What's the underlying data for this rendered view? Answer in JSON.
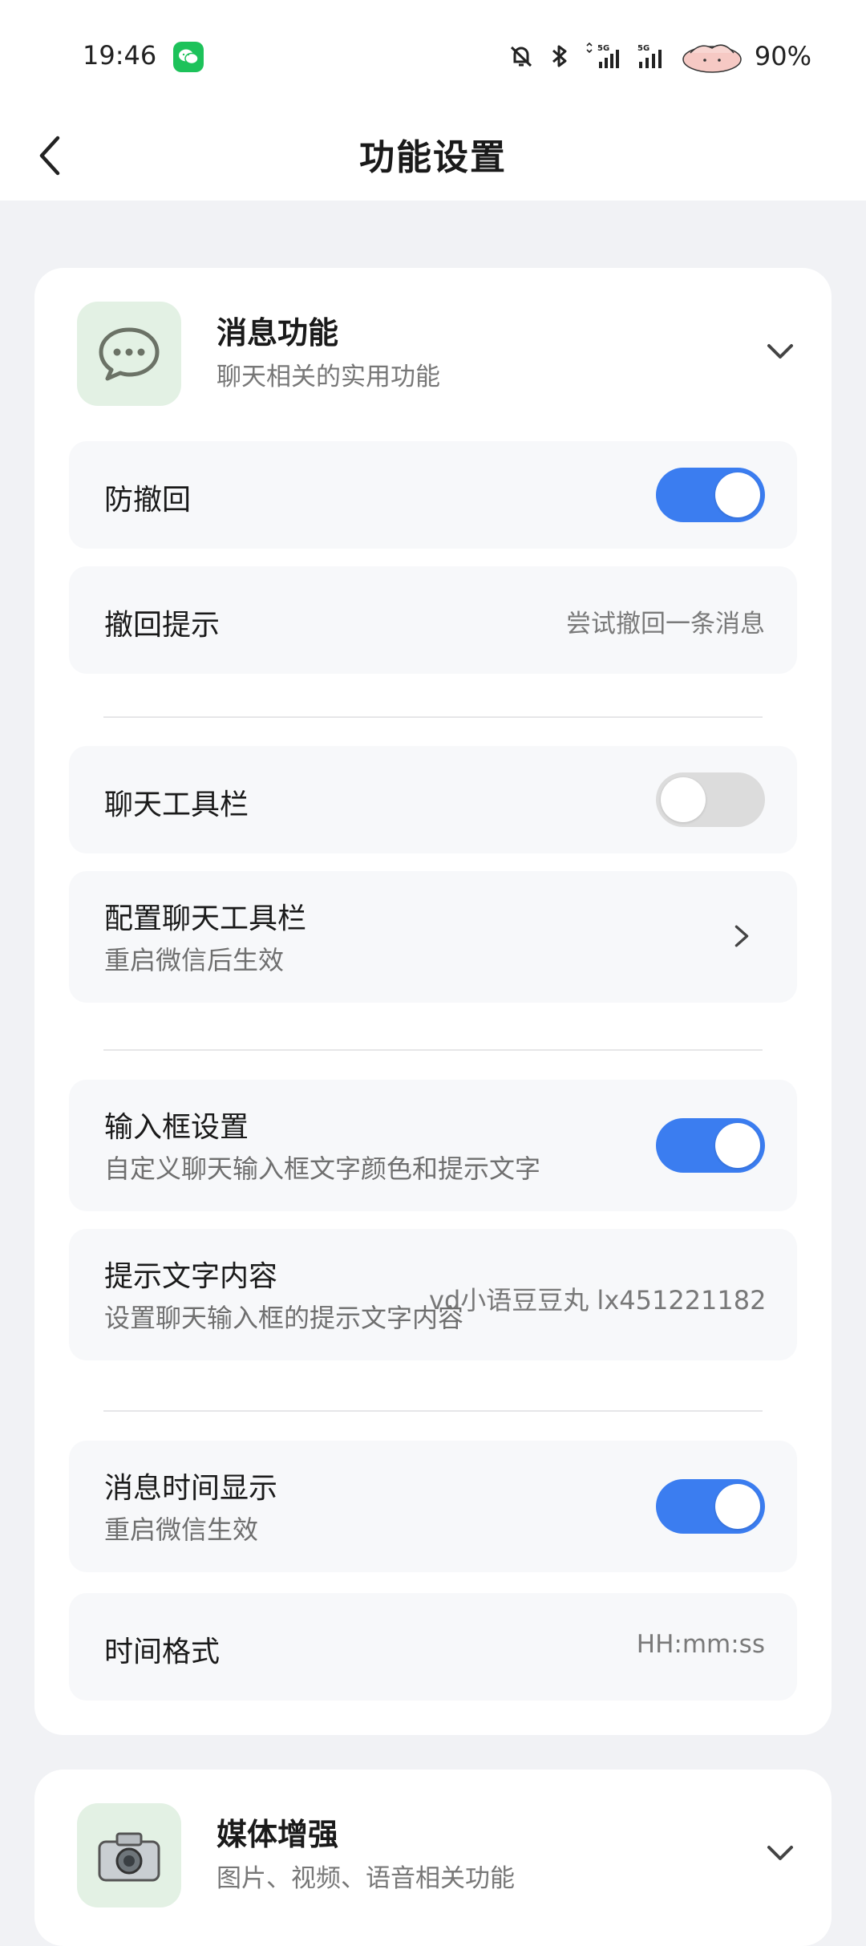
{
  "status_bar": {
    "time": "19:46",
    "battery": "90%",
    "icons": [
      "wechat-icon",
      "mute-icon",
      "bluetooth-icon",
      "signal-5g-icon",
      "signal-5g-icon"
    ]
  },
  "header": {
    "title": "功能设置",
    "back_icon": "chevron-left-icon"
  },
  "sections": [
    {
      "title": "消息功能",
      "subtitle": "聊天相关的实用功能",
      "icon": "chat-bubble-icon",
      "icon_bg": "#e3f1e4",
      "items": [
        {
          "label": "防撤回",
          "control": "toggle",
          "on": true
        },
        {
          "label": "撤回提示",
          "value": "尝试撤回一条消息"
        },
        {
          "label": "聊天工具栏",
          "control": "toggle",
          "on": false
        },
        {
          "label": "配置聊天工具栏",
          "sublabel": "重启微信后生效",
          "control": "chevron"
        },
        {
          "label": "输入框设置",
          "sublabel": "自定义聊天输入框文字颜色和提示文字",
          "control": "toggle",
          "on": true
        },
        {
          "label": "提示文字内容",
          "sublabel": "设置聊天输入框的提示文字内容",
          "value": "vd小语豆豆丸 lx451221182"
        },
        {
          "label": "消息时间显示",
          "sublabel": "重启微信生效",
          "control": "toggle",
          "on": true
        },
        {
          "label": "时间格式",
          "value": "HH:mm:ss"
        }
      ]
    },
    {
      "title": "媒体增强",
      "subtitle": "图片、视频、语音相关功能",
      "icon": "camera-icon"
    }
  ],
  "colors": {
    "toggle_on": "#3b7df0",
    "toggle_off": "#dcdcdc",
    "background": "#f1f2f5"
  }
}
